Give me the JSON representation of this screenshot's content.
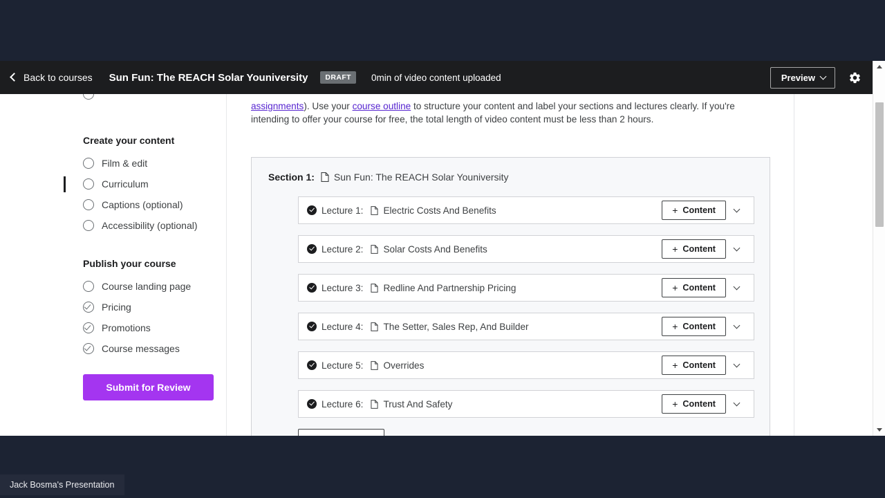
{
  "appbar": {
    "back_label": "Back to courses",
    "back_icon": "chevron-left-icon",
    "course_title": "Sun Fun: The REACH Solar Youniversity",
    "status_badge": "DRAFT",
    "upload_status": "0min of video content uploaded",
    "preview_label": "Preview",
    "preview_caret_icon": "chevron-down-icon",
    "settings_icon": "gear-icon"
  },
  "sidebar": {
    "groups": [
      {
        "title": "Create your content",
        "items": [
          {
            "label": "Film & edit",
            "done": false,
            "active": false
          },
          {
            "label": "Curriculum",
            "done": false,
            "active": true
          },
          {
            "label": "Captions (optional)",
            "done": false,
            "active": false
          },
          {
            "label": "Accessibility (optional)",
            "done": false,
            "active": false
          }
        ]
      },
      {
        "title": "Publish your course",
        "items": [
          {
            "label": "Course landing page",
            "done": false,
            "active": false
          },
          {
            "label": "Pricing",
            "done": true,
            "active": false
          },
          {
            "label": "Promotions",
            "done": true,
            "active": false
          },
          {
            "label": "Course messages",
            "done": true,
            "active": false
          }
        ]
      }
    ],
    "submit_label": "Submit for Review",
    "submit_color": "#a435f0"
  },
  "main": {
    "intro_paragraph": {
      "link1": "assignments",
      "text_a": "). Use your ",
      "link2": "course outline",
      "text_b": " to structure your content and label your sections and lectures clearly. If you're intending to offer your course for free, the total length of video content must be less than 2 hours.",
      "link_color": "#5624d0"
    },
    "section": {
      "label": "Section 1:",
      "doc_icon": "document-icon",
      "title": "Sun Fun: The REACH Solar Youniversity"
    },
    "content_button_label": "Content",
    "content_button_icon": "plus-icon",
    "row_caret_icon": "chevron-down-icon",
    "lectures": [
      {
        "num": "Lecture 1:",
        "title": "Electric Costs And Benefits",
        "complete": true
      },
      {
        "num": "Lecture 2:",
        "title": "Solar Costs And Benefits",
        "complete": true
      },
      {
        "num": "Lecture 3:",
        "title": "Redline And Partnership Pricing",
        "complete": true
      },
      {
        "num": "Lecture 4:",
        "title": "The Setter, Sales Rep, And Builder",
        "complete": true
      },
      {
        "num": "Lecture 5:",
        "title": "Overrides",
        "complete": true
      },
      {
        "num": "Lecture 6:",
        "title": "Trust And Safety",
        "complete": true
      }
    ]
  },
  "taskbar": {
    "window_label": "Jack Bosma's Presentation"
  }
}
